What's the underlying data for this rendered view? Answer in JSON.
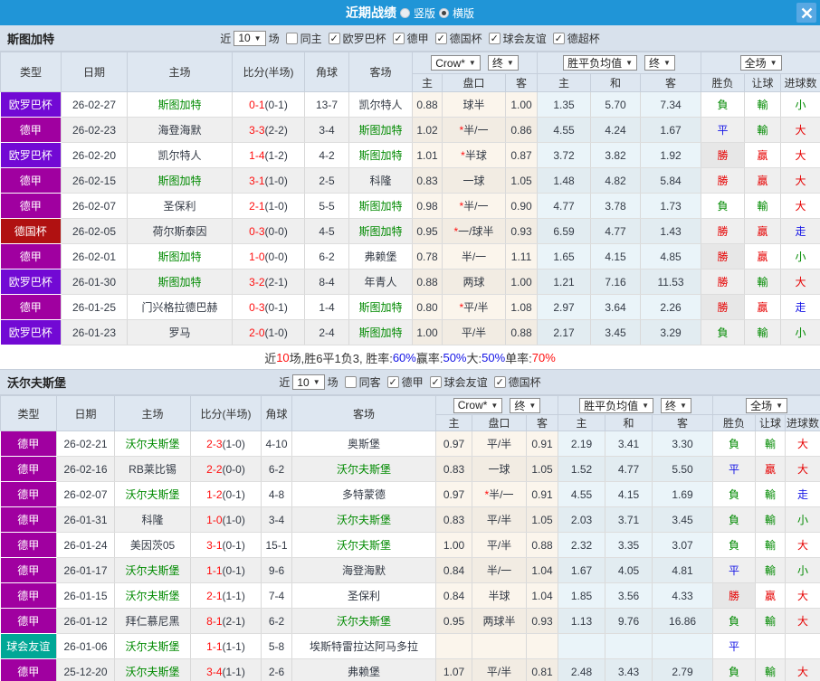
{
  "titlebar": {
    "title": "近期战绩",
    "vertical_label": "竖版",
    "horizontal_label": "横版"
  },
  "colors": {
    "bar": "#2095D7",
    "close_bg": "#58A8E3",
    "comp": {
      "欧罗巴杯": "#7209D4",
      "德甲": "#A000A0",
      "德国杯": "#B01111",
      "球会友谊": "#00A796"
    },
    "result": {
      "勝": "#E60000",
      "贏": "#E60000",
      "大": "#E60000",
      "負": "#008A00",
      "輸": "#008A00",
      "小": "#008A00",
      "平": "#1414E6",
      "走": "#1414E6"
    },
    "team_highlight": "#008A00",
    "score_ft": "#FF0E0E",
    "star": "#FF0E0E"
  },
  "table_header": {
    "type": "类型",
    "date": "日期",
    "home": "主场",
    "score": "比分(半场)",
    "corner": "角球",
    "away": "客场",
    "company": "Crow*",
    "final": "终",
    "avg": "胜平负均值",
    "full": "全场",
    "sub_odds": [
      "主",
      "盘口",
      "客"
    ],
    "sub_avg": [
      "主",
      "和",
      "客"
    ],
    "sub_result": [
      "胜负",
      "让球",
      "进球数"
    ]
  },
  "sections": [
    {
      "team": "斯图加特",
      "filter": {
        "near_label": "近",
        "count": "10",
        "games_label": "场",
        "same_label": "同主",
        "competitions": [
          "欧罗巴杯",
          "德甲",
          "德国杯",
          "球会友谊",
          "德超杯"
        ]
      },
      "rows": [
        {
          "comp": "欧罗巴杯",
          "date": "26-02-27",
          "home": "斯图加特",
          "home_hl": true,
          "ft": "0-1",
          "ht": "(0-1)",
          "corners": "13-7",
          "away": "凯尔特人",
          "away_hl": false,
          "crow": [
            "0.88",
            "球半",
            "1.00"
          ],
          "avg": [
            "1.35",
            "5.70",
            "7.34"
          ],
          "result": [
            "負",
            "輸",
            "小"
          ]
        },
        {
          "comp": "德甲",
          "date": "26-02-23",
          "home": "海登海默",
          "home_hl": false,
          "ft": "3-3",
          "ht": "(2-2)",
          "corners": "3-4",
          "away": "斯图加特",
          "away_hl": true,
          "crow": [
            "1.02",
            "*半/一",
            "0.86"
          ],
          "avg": [
            "4.55",
            "4.24",
            "1.67"
          ],
          "result": [
            "平",
            "輸",
            "大"
          ]
        },
        {
          "comp": "欧罗巴杯",
          "date": "26-02-20",
          "home": "凯尔特人",
          "home_hl": false,
          "ft": "1-4",
          "ht": "(1-2)",
          "corners": "4-2",
          "away": "斯图加特",
          "away_hl": true,
          "crow": [
            "1.01",
            "*半球",
            "0.87"
          ],
          "avg": [
            "3.72",
            "3.82",
            "1.92"
          ],
          "result": [
            "勝",
            "贏",
            "大"
          ]
        },
        {
          "comp": "德甲",
          "date": "26-02-15",
          "home": "斯图加特",
          "home_hl": true,
          "ft": "3-1",
          "ht": "(1-0)",
          "corners": "2-5",
          "away": "科隆",
          "away_hl": false,
          "crow": [
            "0.83",
            "一球",
            "1.05"
          ],
          "avg": [
            "1.48",
            "4.82",
            "5.84"
          ],
          "result": [
            "勝",
            "贏",
            "大"
          ]
        },
        {
          "comp": "德甲",
          "date": "26-02-07",
          "home": "圣保利",
          "home_hl": false,
          "ft": "2-1",
          "ht": "(1-0)",
          "corners": "5-5",
          "away": "斯图加特",
          "away_hl": true,
          "crow": [
            "0.98",
            "*半/一",
            "0.90"
          ],
          "avg": [
            "4.77",
            "3.78",
            "1.73"
          ],
          "result": [
            "負",
            "輸",
            "大"
          ]
        },
        {
          "comp": "德国杯",
          "date": "26-02-05",
          "home": "荷尔斯泰因",
          "home_hl": false,
          "ft": "0-3",
          "ht": "(0-0)",
          "corners": "4-5",
          "away": "斯图加特",
          "away_hl": true,
          "crow": [
            "0.95",
            "*一/球半",
            "0.93"
          ],
          "avg": [
            "6.59",
            "4.77",
            "1.43"
          ],
          "result": [
            "勝",
            "贏",
            "走"
          ]
        },
        {
          "comp": "德甲",
          "date": "26-02-01",
          "home": "斯图加特",
          "home_hl": true,
          "ft": "1-0",
          "ht": "(0-0)",
          "corners": "6-2",
          "away": "弗赖堡",
          "away_hl": false,
          "crow": [
            "0.78",
            "半/一",
            "1.11"
          ],
          "avg": [
            "1.65",
            "4.15",
            "4.85"
          ],
          "result": [
            "勝",
            "贏",
            "小"
          ]
        },
        {
          "comp": "欧罗巴杯",
          "date": "26-01-30",
          "home": "斯图加特",
          "home_hl": true,
          "ft": "3-2",
          "ht": "(2-1)",
          "corners": "8-4",
          "away": "年青人",
          "away_hl": false,
          "crow": [
            "0.88",
            "两球",
            "1.00"
          ],
          "avg": [
            "1.21",
            "7.16",
            "11.53"
          ],
          "result": [
            "勝",
            "輸",
            "大"
          ]
        },
        {
          "comp": "德甲",
          "date": "26-01-25",
          "home": "门兴格拉德巴赫",
          "home_hl": false,
          "ft": "0-3",
          "ht": "(0-1)",
          "corners": "1-4",
          "away": "斯图加特",
          "away_hl": true,
          "crow": [
            "0.80",
            "*平/半",
            "1.08"
          ],
          "avg": [
            "2.97",
            "3.64",
            "2.26"
          ],
          "result": [
            "勝",
            "贏",
            "走"
          ]
        },
        {
          "comp": "欧罗巴杯",
          "date": "26-01-23",
          "home": "罗马",
          "home_hl": false,
          "ft": "2-0",
          "ht": "(1-0)",
          "corners": "2-4",
          "away": "斯图加特",
          "away_hl": true,
          "crow": [
            "1.00",
            "平/半",
            "0.88"
          ],
          "avg": [
            "2.17",
            "3.45",
            "3.29"
          ],
          "result": [
            "負",
            "輸",
            "小"
          ]
        }
      ],
      "summary": [
        {
          "text": "近",
          "color": "#333333"
        },
        {
          "text": "10",
          "color": "#FF0E0E"
        },
        {
          "text": "场,胜6平1负3, 胜率:",
          "color": "#333333"
        },
        {
          "text": "60%",
          "color": "#1414E6"
        },
        {
          "text": " 赢率:",
          "color": "#333333"
        },
        {
          "text": "50%",
          "color": "#1414E6"
        },
        {
          "text": " 大:",
          "color": "#333333"
        },
        {
          "text": "50%",
          "color": "#1414E6"
        },
        {
          "text": " 单率:",
          "color": "#333333"
        },
        {
          "text": "70%",
          "color": "#FF0E0E"
        }
      ]
    },
    {
      "team": "沃尔夫斯堡",
      "filter": {
        "near_label": "近",
        "count": "10",
        "games_label": "场",
        "same_label": "同客",
        "competitions": [
          "德甲",
          "球会友谊",
          "德国杯"
        ]
      },
      "rows": [
        {
          "comp": "德甲",
          "date": "26-02-21",
          "home": "沃尔夫斯堡",
          "home_hl": true,
          "ft": "2-3",
          "ht": "(1-0)",
          "corners": "4-10",
          "away": "奥斯堡",
          "away_hl": false,
          "crow": [
            "0.97",
            "平/半",
            "0.91"
          ],
          "avg": [
            "2.19",
            "3.41",
            "3.30"
          ],
          "result": [
            "負",
            "輸",
            "大"
          ]
        },
        {
          "comp": "德甲",
          "date": "26-02-16",
          "home": "RB莱比锡",
          "home_hl": false,
          "ft": "2-2",
          "ht": "(0-0)",
          "corners": "6-2",
          "away": "沃尔夫斯堡",
          "away_hl": true,
          "crow": [
            "0.83",
            "一球",
            "1.05"
          ],
          "avg": [
            "1.52",
            "4.77",
            "5.50"
          ],
          "result": [
            "平",
            "贏",
            "大"
          ]
        },
        {
          "comp": "德甲",
          "date": "26-02-07",
          "home": "沃尔夫斯堡",
          "home_hl": true,
          "ft": "1-2",
          "ht": "(0-1)",
          "corners": "4-8",
          "away": "多特蒙德",
          "away_hl": false,
          "crow": [
            "0.97",
            "*半/一",
            "0.91"
          ],
          "avg": [
            "4.55",
            "4.15",
            "1.69"
          ],
          "result": [
            "負",
            "輸",
            "走"
          ]
        },
        {
          "comp": "德甲",
          "date": "26-01-31",
          "home": "科隆",
          "home_hl": false,
          "ft": "1-0",
          "ht": "(1-0)",
          "corners": "3-4",
          "away": "沃尔夫斯堡",
          "away_hl": true,
          "crow": [
            "0.83",
            "平/半",
            "1.05"
          ],
          "avg": [
            "2.03",
            "3.71",
            "3.45"
          ],
          "result": [
            "負",
            "輸",
            "小"
          ]
        },
        {
          "comp": "德甲",
          "date": "26-01-24",
          "home": "美因茨05",
          "home_hl": false,
          "ft": "3-1",
          "ht": "(0-1)",
          "corners": "15-1",
          "away": "沃尔夫斯堡",
          "away_hl": true,
          "crow": [
            "1.00",
            "平/半",
            "0.88"
          ],
          "avg": [
            "2.32",
            "3.35",
            "3.07"
          ],
          "result": [
            "負",
            "輸",
            "大"
          ]
        },
        {
          "comp": "德甲",
          "date": "26-01-17",
          "home": "沃尔夫斯堡",
          "home_hl": true,
          "ft": "1-1",
          "ht": "(0-1)",
          "corners": "9-6",
          "away": "海登海默",
          "away_hl": false,
          "crow": [
            "0.84",
            "半/一",
            "1.04"
          ],
          "avg": [
            "1.67",
            "4.05",
            "4.81"
          ],
          "result": [
            "平",
            "輸",
            "小"
          ]
        },
        {
          "comp": "德甲",
          "date": "26-01-15",
          "home": "沃尔夫斯堡",
          "home_hl": true,
          "ft": "2-1",
          "ht": "(1-1)",
          "corners": "7-4",
          "away": "圣保利",
          "away_hl": false,
          "crow": [
            "0.84",
            "半球",
            "1.04"
          ],
          "avg": [
            "1.85",
            "3.56",
            "4.33"
          ],
          "result": [
            "勝",
            "贏",
            "大"
          ]
        },
        {
          "comp": "德甲",
          "date": "26-01-12",
          "home": "拜仁慕尼黑",
          "home_hl": false,
          "ft": "8-1",
          "ht": "(2-1)",
          "corners": "6-2",
          "away": "沃尔夫斯堡",
          "away_hl": true,
          "crow": [
            "0.95",
            "两球半",
            "0.93"
          ],
          "avg": [
            "1.13",
            "9.76",
            "16.86"
          ],
          "result": [
            "負",
            "輸",
            "大"
          ]
        },
        {
          "comp": "球会友谊",
          "date": "26-01-06",
          "home": "沃尔夫斯堡",
          "home_hl": true,
          "ft": "1-1",
          "ht": "(1-1)",
          "corners": "5-8",
          "away": "埃斯特雷拉达阿马多拉",
          "away_hl": false,
          "crow": [
            "",
            "",
            ""
          ],
          "avg": [
            "",
            "",
            ""
          ],
          "result": [
            "平",
            "",
            ""
          ]
        },
        {
          "comp": "德甲",
          "date": "25-12-20",
          "home": "沃尔夫斯堡",
          "home_hl": true,
          "ft": "3-4",
          "ht": "(1-1)",
          "corners": "2-6",
          "away": "弗赖堡",
          "away_hl": false,
          "crow": [
            "1.07",
            "平/半",
            "0.81"
          ],
          "avg": [
            "2.48",
            "3.43",
            "2.79"
          ],
          "result": [
            "負",
            "輸",
            "大"
          ]
        }
      ],
      "summary": null
    }
  ]
}
